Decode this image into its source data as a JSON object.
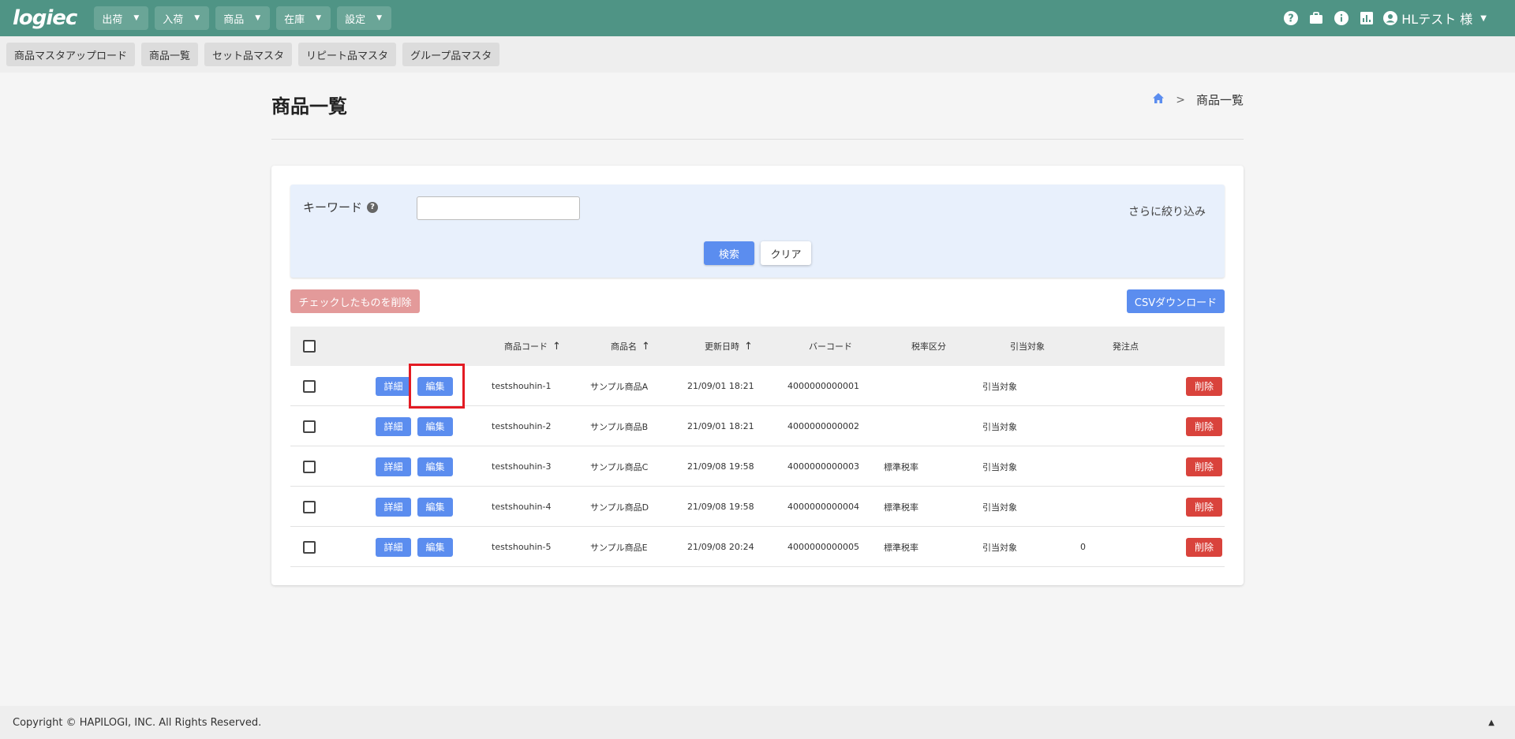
{
  "header": {
    "logo": "logiec",
    "nav": [
      {
        "label": "出荷"
      },
      {
        "label": "入荷"
      },
      {
        "label": "商品"
      },
      {
        "label": "在庫"
      },
      {
        "label": "設定"
      }
    ],
    "icons": [
      "help-icon",
      "briefcase-icon",
      "info-icon",
      "chart-icon",
      "account-icon"
    ],
    "user": "HLテスト 様"
  },
  "subnav": [
    {
      "label": "商品マスタアップロード"
    },
    {
      "label": "商品一覧"
    },
    {
      "label": "セット品マスタ"
    },
    {
      "label": "リピート品マスタ"
    },
    {
      "label": "グループ品マスタ"
    }
  ],
  "page": {
    "title": "商品一覧",
    "breadcrumb_current": "商品一覧"
  },
  "search": {
    "keyword_label": "キーワード",
    "keyword_value": "",
    "more_filters": "さらに絞り込み",
    "search_button": "検索",
    "clear_button": "クリア"
  },
  "actions": {
    "delete_checked": "チェックしたものを削除",
    "csv_download": "CSVダウンロード"
  },
  "table": {
    "columns": {
      "code": "商品コード",
      "name": "商品名",
      "updated": "更新日時",
      "barcode": "バーコード",
      "tax": "税率区分",
      "allocation": "引当対象",
      "reorder": "発注点"
    },
    "detail_label": "詳細",
    "edit_label": "編集",
    "delete_label": "削除",
    "rows": [
      {
        "code": "testshouhin-1",
        "name": "サンプル商品A",
        "updated": "21/09/01 18:21",
        "barcode": "4000000000001",
        "tax": "",
        "allocation": "引当対象",
        "reorder": ""
      },
      {
        "code": "testshouhin-2",
        "name": "サンプル商品B",
        "updated": "21/09/01 18:21",
        "barcode": "4000000000002",
        "tax": "",
        "allocation": "引当対象",
        "reorder": ""
      },
      {
        "code": "testshouhin-3",
        "name": "サンプル商品C",
        "updated": "21/09/08 19:58",
        "barcode": "4000000000003",
        "tax": "標準税率",
        "allocation": "引当対象",
        "reorder": ""
      },
      {
        "code": "testshouhin-4",
        "name": "サンプル商品D",
        "updated": "21/09/08 19:58",
        "barcode": "4000000000004",
        "tax": "標準税率",
        "allocation": "引当対象",
        "reorder": ""
      },
      {
        "code": "testshouhin-5",
        "name": "サンプル商品E",
        "updated": "21/09/08 20:24",
        "barcode": "4000000000005",
        "tax": "標準税率",
        "allocation": "引当対象",
        "reorder": "0"
      }
    ]
  },
  "footer": {
    "copyright": "Copyright © HAPILOGI, INC. All Rights Reserved."
  },
  "colors": {
    "header": "#4f9485",
    "primary": "#5b8def",
    "danger": "#d9433c",
    "highlight": "#e31b23"
  }
}
